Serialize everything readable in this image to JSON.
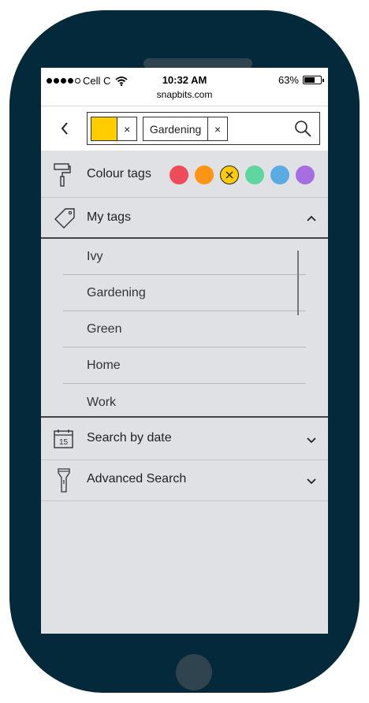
{
  "status_bar": {
    "carrier": "Cell C",
    "time": "10:32 AM",
    "battery": "63%",
    "url": "snapbits.com"
  },
  "search": {
    "back_icon": "chevron-left-icon",
    "chips": [
      {
        "type": "color",
        "color": "#ffcc00"
      },
      {
        "type": "text",
        "label": "Gardening"
      }
    ],
    "remove_glyph": "×",
    "search_icon": "search-icon"
  },
  "colour_tags": {
    "label": "Colour tags",
    "icon": "paint-roller-icon",
    "colors": [
      "#f04b59",
      "#ff9415",
      "#ffcc00",
      "#5fd6a0",
      "#5aabe1",
      "#a66ee0"
    ],
    "selected_index": 2
  },
  "my_tags": {
    "label": "My tags",
    "icon": "tag-icon",
    "expanded": true,
    "items": [
      "Ivy",
      "Gardening",
      "Green",
      "Home",
      "Work"
    ]
  },
  "search_by_date": {
    "label": "Search by date",
    "icon": "calendar-icon",
    "calendar_day": "15"
  },
  "advanced_search": {
    "label": "Advanced Search",
    "icon": "flashlight-icon"
  }
}
